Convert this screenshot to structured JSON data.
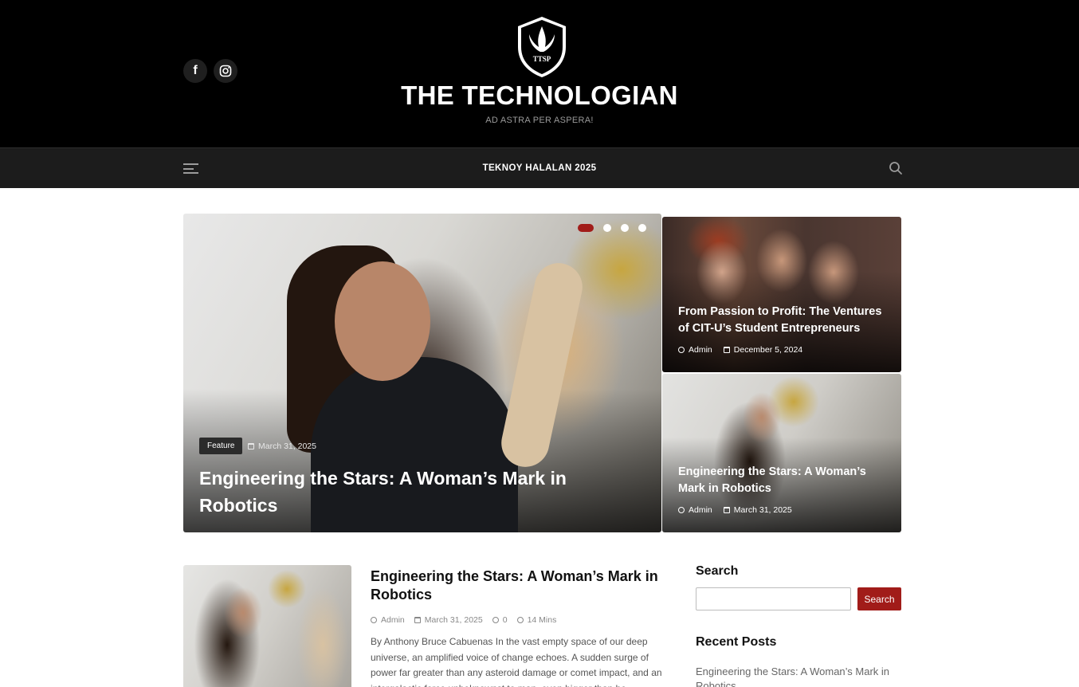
{
  "header": {
    "site_title": "THE TECHNOLOGIAN",
    "tagline": "AD ASTRA PER ASPERA!",
    "logo_text": "TTSP",
    "social": [
      {
        "icon": "facebook-icon",
        "glyph": "f"
      },
      {
        "icon": "instagram-icon",
        "glyph": "◎"
      }
    ]
  },
  "nav": {
    "menu_icon": "hamburger-menu-icon",
    "link": "TEKNOY HALALAN 2025",
    "search_icon": "search-icon"
  },
  "hero": {
    "active_slide": 1,
    "slide_count": 4,
    "category": "Feature",
    "date": "March 31, 2025",
    "title": "Engineering the Stars: A Woman’s Mark in Robotics"
  },
  "side_cards": [
    {
      "title": "From Passion to Profit: The Ventures of CIT-U’s Student Entrepreneurs",
      "author": "Admin",
      "date": "December 5, 2024"
    },
    {
      "title": "Engineering the Stars: A Woman’s Mark in Robotics",
      "author": "Admin",
      "date": "March 31, 2025"
    }
  ],
  "post": {
    "title": "Engineering the Stars: A Woman’s Mark in Robotics",
    "author": "Admin",
    "date": "March 31, 2025",
    "comments": "0",
    "read_time": "14 Mins",
    "excerpt": "By Anthony Bruce Cabuenas In the vast empty space of our deep universe, an amplified voice of change echoes. A sudden surge of power far greater than any asteroid damage or comet impact, and an intergalactic force unbeknownst to man, even bigger than he"
  },
  "sidebar": {
    "search_title": "Search",
    "search_placeholder": "",
    "search_button": "Search",
    "recent_title": "Recent Posts",
    "recent_items": [
      "Engineering the Stars: A Woman’s Mark in Robotics"
    ]
  },
  "colors": {
    "accent": "#a11c19",
    "header_bg": "#000000",
    "nav_bg": "#1c1c1c"
  }
}
